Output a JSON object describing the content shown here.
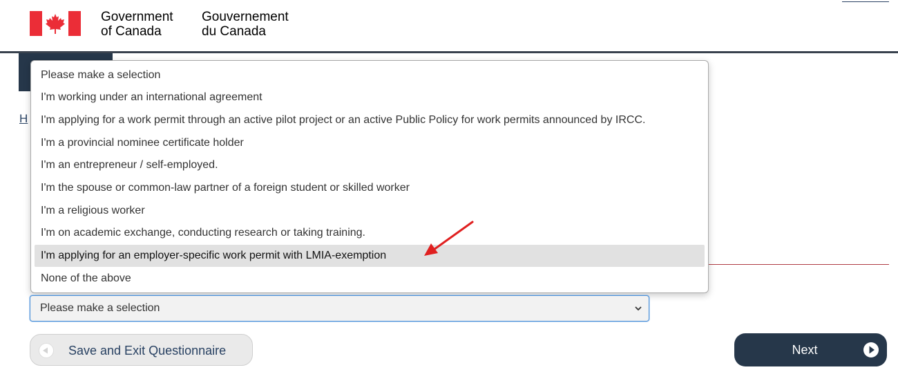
{
  "header": {
    "signature_en_line1": "Government",
    "signature_en_line2": "of Canada",
    "signature_fr_line1": "Gouvernement",
    "signature_fr_line2": "du Canada",
    "flag_icon": "canada-flag-icon"
  },
  "breadcrumb": {
    "visible_text": "H"
  },
  "dropdown": {
    "options": [
      "Please make a selection",
      "I'm working under an international agreement",
      "I'm applying for a work permit through an active pilot project or an active Public Policy for work permits announced by IRCC.",
      "I'm a provincial nominee certificate holder",
      "I'm an entrepreneur / self-employed.",
      "I'm the spouse or common-law partner of a foreign student or skilled worker",
      "I'm a religious worker",
      "I'm on academic exchange, conducting research or taking training.",
      "I'm applying for an employer-specific work permit with LMIA-exemption",
      "None of the above"
    ],
    "highlighted_option": "I'm applying for an employer-specific work permit with LMIA-exemption",
    "annotation": "red-arrow-icon"
  },
  "select": {
    "value": "Please make a selection",
    "icon": "chevron-down-icon"
  },
  "buttons": {
    "save_label": "Save and Exit Questionnaire",
    "save_icon": "circle-arrow-left-icon",
    "next_label": "Next",
    "next_icon": "circle-arrow-right-icon"
  },
  "colors": {
    "header_rule": "#38414d",
    "dark_navy": "#26374a",
    "link_blue": "#284162",
    "flag_red": "#eb2d37",
    "annotation_red": "#e02020",
    "accent_red_line": "#af3c43"
  }
}
